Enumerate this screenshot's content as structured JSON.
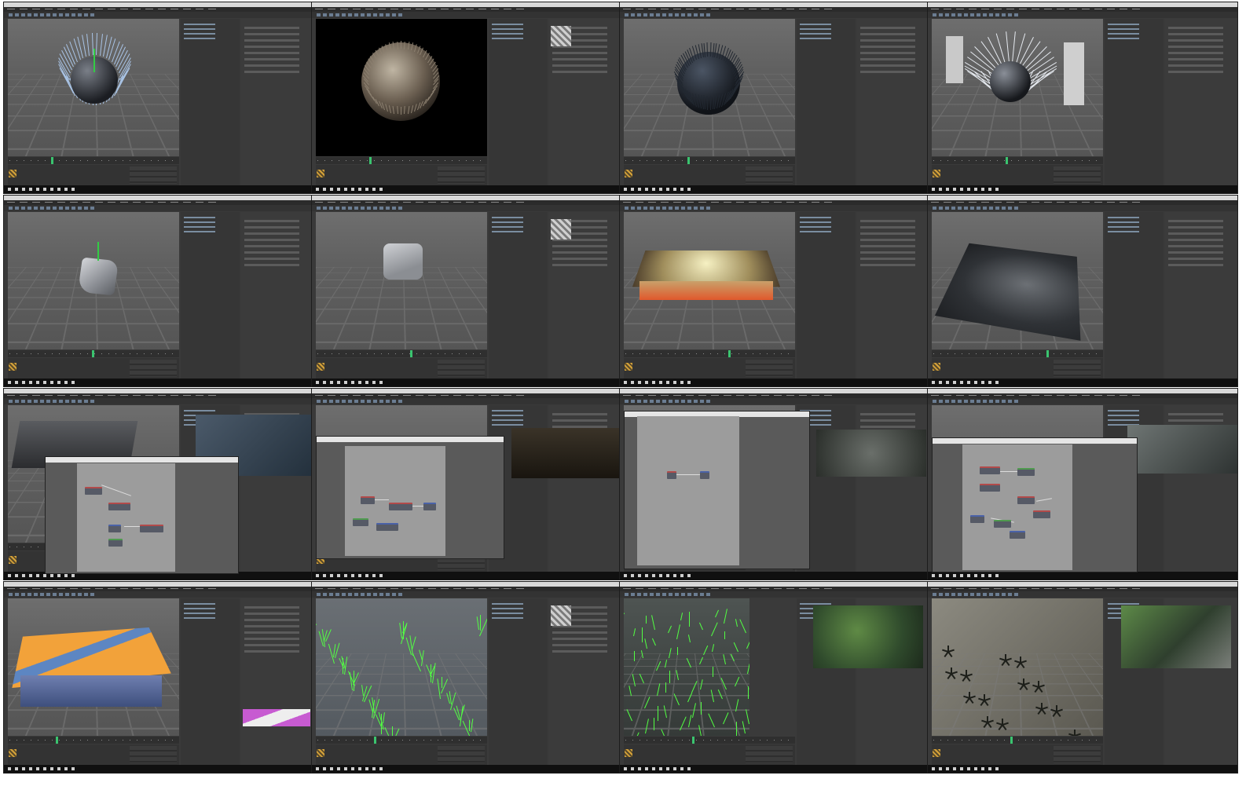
{
  "sheet": {
    "columns": 4,
    "rows": 4,
    "thumbs": [
      {
        "id": 1,
        "icon": "hair-guides-icon",
        "scene": "hair-guides-sphere"
      },
      {
        "id": 2,
        "icon": "render-icon",
        "scene": "fur-render"
      },
      {
        "id": 3,
        "icon": "hair-icon",
        "scene": "dark-hair-sphere"
      },
      {
        "id": 4,
        "icon": "hair-curl-icon",
        "scene": "curled-hair-sphere"
      },
      {
        "id": 5,
        "icon": "cube-icon",
        "scene": "deformed-cube"
      },
      {
        "id": 6,
        "icon": "cube-icon",
        "scene": "rounded-cube"
      },
      {
        "id": 7,
        "icon": "terrain-icon",
        "scene": "displaced-slab"
      },
      {
        "id": 8,
        "icon": "terrain-icon",
        "scene": "rock-terrain"
      },
      {
        "id": 9,
        "icon": "node-editor-icon",
        "scene": "terrain-node-editor"
      },
      {
        "id": 10,
        "icon": "node-editor-icon",
        "scene": "material-node-editor"
      },
      {
        "id": 11,
        "icon": "node-editor-icon",
        "scene": "empty-node-editor"
      },
      {
        "id": 12,
        "icon": "node-editor-icon",
        "scene": "complex-node-editor"
      },
      {
        "id": 13,
        "icon": "terrain-icon",
        "scene": "orange-blue-terrain"
      },
      {
        "id": 14,
        "icon": "grass-icon",
        "scene": "grass-field"
      },
      {
        "id": 15,
        "icon": "grass-icon",
        "scene": "grass-terrain-render"
      },
      {
        "id": 16,
        "icon": "plant-icon",
        "scene": "plants-on-terrain"
      }
    ]
  },
  "colors": {
    "app_bg": "#3a3a3a",
    "viewport": "#606060",
    "titlebar": "#d9d9d9",
    "grass": "#52ff43",
    "terrain_orange": "#f2a23a",
    "terrain_blue": "#5d86c2",
    "gradient_magenta": "#c75bd1"
  }
}
